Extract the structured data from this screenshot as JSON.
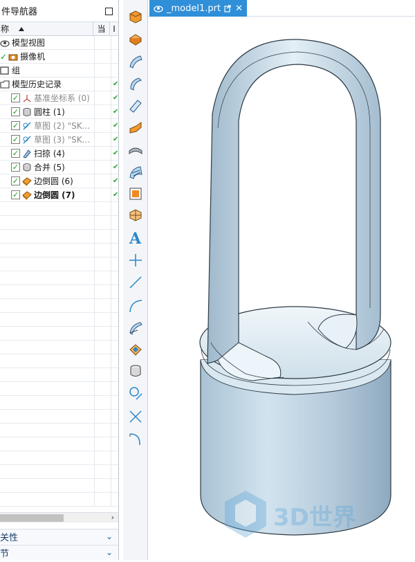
{
  "navigator": {
    "title": "部件导航器",
    "title_visible": "件导航器",
    "col_name": "称",
    "col_current": "当",
    "col_extra": "I"
  },
  "tree": [
    {
      "label": "模型视图",
      "indent": 0,
      "icon": "model-views-icon",
      "check": false,
      "style": "normal"
    },
    {
      "label": "摄像机",
      "indent": 0,
      "icon": "camera-icon",
      "check": true,
      "style": "normal"
    },
    {
      "label": "组",
      "indent": 0,
      "icon": "group-icon",
      "check": false,
      "style": "normal"
    },
    {
      "label": "模型历史记录",
      "indent": 0,
      "icon": "folder-icon",
      "check": false,
      "style": "normal"
    },
    {
      "label": "基准坐标系 (0)",
      "indent": 1,
      "icon": "datum-csys-icon",
      "check": true,
      "style": "grey"
    },
    {
      "label": "圆柱 (1)",
      "indent": 1,
      "icon": "cylinder-icon",
      "check": true,
      "style": "normal"
    },
    {
      "label": "草图 (2) \"SK...",
      "indent": 1,
      "icon": "sketch-icon",
      "check": true,
      "style": "grey"
    },
    {
      "label": "草图 (3) \"SK...",
      "indent": 1,
      "icon": "sketch-icon",
      "check": true,
      "style": "grey"
    },
    {
      "label": "扫掠 (4)",
      "indent": 1,
      "icon": "swept-icon",
      "check": true,
      "style": "normal"
    },
    {
      "label": "合并 (5)",
      "indent": 1,
      "icon": "unite-icon",
      "check": true,
      "style": "normal"
    },
    {
      "label": "边倒圆 (6)",
      "indent": 1,
      "icon": "edge-blend-icon",
      "check": true,
      "style": "normal"
    },
    {
      "label": "边倒圆 (7)",
      "indent": 1,
      "icon": "edge-blend-icon",
      "check": true,
      "style": "bold"
    }
  ],
  "sections": {
    "dependencies": "关性",
    "details": "节"
  },
  "tab": {
    "label": "_model1.prt",
    "close": "✕"
  },
  "toolbar": [
    "block-icon",
    "extrude-icon",
    "surface-icon",
    "swept-surface-icon",
    "bounded-plane-icon",
    "flange-icon",
    "tube-icon",
    "mesh-surface-icon",
    "face-icon",
    "solid-body-icon",
    "text-icon",
    "point-icon",
    "line-icon",
    "arc-icon",
    "offset-face-icon",
    "trim-body-icon",
    "cylinder-tool-icon",
    "circle-tool-icon",
    "cross-icon",
    "fillet-curve-icon"
  ],
  "toolbar_text_a": "A",
  "watermark": "3D世界",
  "colors": {
    "accent": "#2f8fd8",
    "check": "#1a9a1a",
    "model": "#c4d8e6"
  }
}
